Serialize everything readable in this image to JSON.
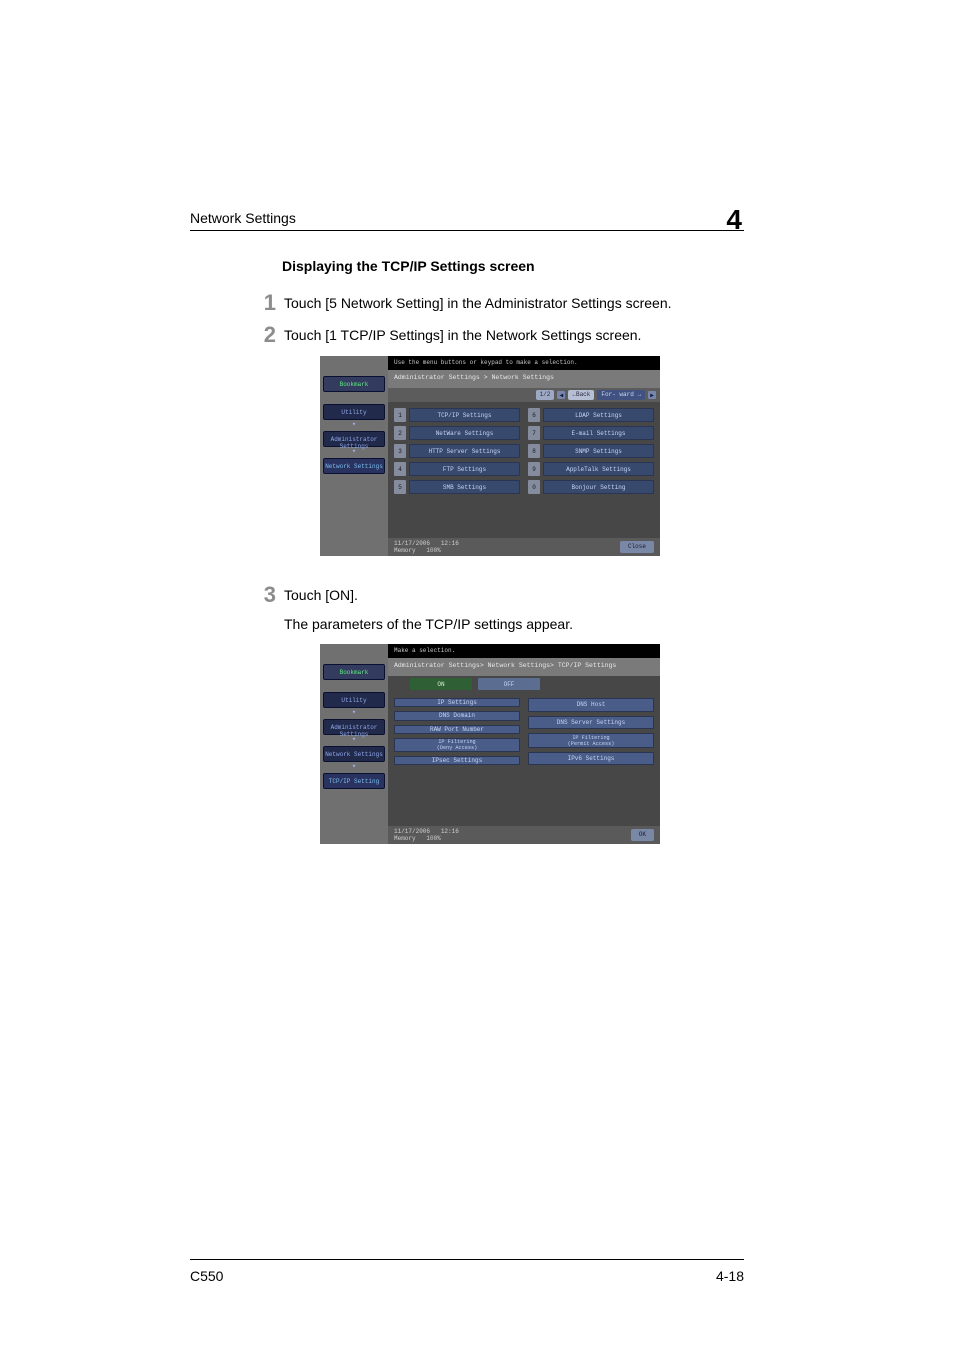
{
  "header": {
    "section": "Network Settings",
    "chapter": "4"
  },
  "sectionTitle": "Displaying the TCP/IP Settings screen",
  "steps": {
    "s1": {
      "num": "1",
      "text": "Touch [5 Network Setting] in the Administrator Settings screen."
    },
    "s2": {
      "num": "2",
      "text": "Touch [1 TCP/IP Settings] in the Network Settings screen."
    },
    "s3": {
      "num": "3",
      "text": "Touch [ON].",
      "sub": "The parameters of the TCP/IP settings appear."
    }
  },
  "mock1": {
    "topMsg": "Use the menu buttons or keypad to make a selection.",
    "breadcrumb": "Administrator Settings > Network Settings",
    "pageNav": {
      "page": "1/2",
      "back": "←Back",
      "fwd": "For-\nward →"
    },
    "sidebar": {
      "bookmark": "Bookmark",
      "items": [
        "Utility",
        "Administrator\nSettings",
        "Network\nSettings"
      ]
    },
    "left": [
      {
        "n": "1",
        "l": "TCP/IP Settings"
      },
      {
        "n": "2",
        "l": "NetWare Settings"
      },
      {
        "n": "3",
        "l": "HTTP Server Settings"
      },
      {
        "n": "4",
        "l": "FTP Settings"
      },
      {
        "n": "5",
        "l": "SMB Settings"
      }
    ],
    "right": [
      {
        "n": "6",
        "l": "LDAP Settings"
      },
      {
        "n": "7",
        "l": "E-mail Settings"
      },
      {
        "n": "8",
        "l": "SNMP Settings"
      },
      {
        "n": "9",
        "l": "AppleTalk Settings"
      },
      {
        "n": "0",
        "l": "Bonjour Setting"
      }
    ],
    "footer": {
      "date": "11/17/2006",
      "time": "12:16",
      "mem": "Memory",
      "mempct": "100%",
      "close": "Close"
    }
  },
  "mock2": {
    "topMsg": "Make a selection.",
    "breadcrumb": "Administrator Settings> Network Settings> TCP/IP Settings",
    "toggle": {
      "on": "ON",
      "off": "OFF"
    },
    "sidebar": {
      "bookmark": "Bookmark",
      "items": [
        "Utility",
        "Administrator\nSettings",
        "Network\nSettings",
        "TCP/IP Setting"
      ]
    },
    "left": [
      "IP Settings",
      "DNS Domain",
      "RAW Port Number",
      "IP Filtering\n(Deny Access)",
      "IPsec Settings"
    ],
    "right": [
      "DNS Host",
      "DNS Server Settings",
      "IP Filtering\n(Permit Access)",
      "IPv6 Settings"
    ],
    "footer": {
      "date": "11/17/2006",
      "time": "12:16",
      "mem": "Memory",
      "mempct": "100%",
      "ok": "OK"
    }
  },
  "pageFooter": {
    "left": "C550",
    "right": "4-18"
  }
}
